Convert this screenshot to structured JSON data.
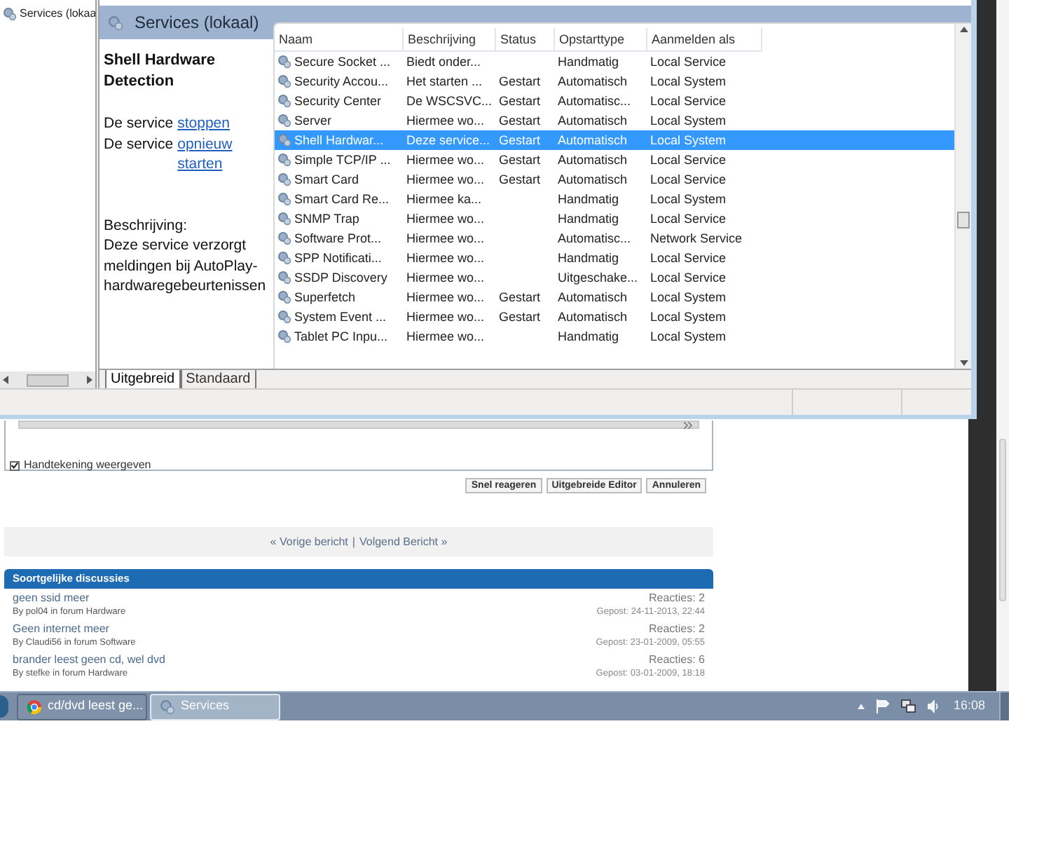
{
  "tree": {
    "item": "Services (lokaa"
  },
  "header": {
    "title": "Services (lokaal)"
  },
  "detail": {
    "name": "Shell Hardware Detection",
    "actions": [
      {
        "prefix": "De service",
        "link": "stoppen"
      },
      {
        "prefix": "De service",
        "link": "opnieuw starten"
      }
    ],
    "description_label": "Beschrijving:",
    "description": "Deze service verzorgt meldingen bij AutoPlay-hardwaregebeurtenissen"
  },
  "table": {
    "columns": [
      "Naam",
      "Beschrijving",
      "Status",
      "Opstarttype",
      "Aanmelden als"
    ],
    "rows": [
      {
        "cells": [
          "Secure Socket ...",
          "Biedt onder...",
          "",
          "Handmatig",
          "Local Service"
        ],
        "selected": false
      },
      {
        "cells": [
          "Security Accou...",
          "Het starten ...",
          "Gestart",
          "Automatisch",
          "Local System"
        ],
        "selected": false
      },
      {
        "cells": [
          "Security Center",
          "De WSCSVC...",
          "Gestart",
          "Automatisc...",
          "Local Service"
        ],
        "selected": false
      },
      {
        "cells": [
          "Server",
          "Hiermee wo...",
          "Gestart",
          "Automatisch",
          "Local System"
        ],
        "selected": false
      },
      {
        "cells": [
          "Shell Hardwar...",
          "Deze service...",
          "Gestart",
          "Automatisch",
          "Local System"
        ],
        "selected": true
      },
      {
        "cells": [
          "Simple TCP/IP ...",
          "Hiermee wo...",
          "Gestart",
          "Automatisch",
          "Local Service"
        ],
        "selected": false
      },
      {
        "cells": [
          "Smart Card",
          "Hiermee wo...",
          "Gestart",
          "Automatisch",
          "Local Service"
        ],
        "selected": false
      },
      {
        "cells": [
          "Smart Card Re...",
          "Hiermee ka...",
          "",
          "Handmatig",
          "Local System"
        ],
        "selected": false
      },
      {
        "cells": [
          "SNMP Trap",
          "Hiermee wo...",
          "",
          "Handmatig",
          "Local Service"
        ],
        "selected": false
      },
      {
        "cells": [
          "Software Prot...",
          "Hiermee wo...",
          "",
          "Automatisc...",
          "Network Service"
        ],
        "selected": false
      },
      {
        "cells": [
          "SPP Notificati...",
          "Hiermee wo...",
          "",
          "Handmatig",
          "Local Service"
        ],
        "selected": false
      },
      {
        "cells": [
          "SSDP Discovery",
          "Hiermee wo...",
          "",
          "Uitgeschake...",
          "Local Service"
        ],
        "selected": false
      },
      {
        "cells": [
          "Superfetch",
          "Hiermee wo...",
          "Gestart",
          "Automatisch",
          "Local System"
        ],
        "selected": false
      },
      {
        "cells": [
          "System Event ...",
          "Hiermee wo...",
          "Gestart",
          "Automatisch",
          "Local System"
        ],
        "selected": false
      },
      {
        "cells": [
          "Tablet PC Inpu...",
          "Hiermee wo...",
          "",
          "Handmatig",
          "Local System"
        ],
        "selected": false
      }
    ]
  },
  "tabs": [
    {
      "label": "Uitgebreid",
      "selected": true
    },
    {
      "label": "Standaard",
      "selected": false
    }
  ],
  "forum": {
    "signature": {
      "label": "Handtekening weergeven",
      "checked": true
    },
    "buttons": [
      "Snel reageren",
      "Uitgebreide Editor",
      "Annuleren"
    ],
    "nav": {
      "previous": "« Vorige bericht",
      "separator": "|",
      "next": "Volgend Bericht »"
    },
    "similar": {
      "title": "Soortgelijke discussies",
      "threads": [
        {
          "title": "geen ssid meer",
          "by": "By pol04 in forum Hardware",
          "replies": "Reacties: 2",
          "posted": "Gepost: 24-11-2013, 22:44"
        },
        {
          "title": "Geen internet meer",
          "by": "By Claudi56 in forum Software",
          "replies": "Reacties: 2",
          "posted": "Gepost: 23-01-2009, 05:55"
        },
        {
          "title": "brander leest geen cd, wel dvd",
          "by": "By stefke in forum Hardware",
          "replies": "Reacties: 6",
          "posted": "Gepost: 03-01-2009, 18:18"
        }
      ]
    }
  },
  "taskbar": {
    "tasks": [
      {
        "label": "cd/dvd leest ge...",
        "kind": "browser",
        "selected": false
      },
      {
        "label": "Services",
        "kind": "services",
        "selected": true
      }
    ],
    "clock": "16:08"
  }
}
